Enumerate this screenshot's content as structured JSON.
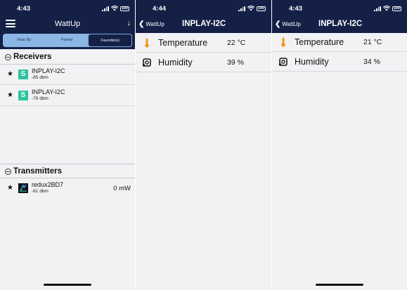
{
  "screens": [
    {
      "status_time": "4:43",
      "battery": "100",
      "app_title": "WattUp",
      "tabs": [
        "Near By",
        "Paired",
        "Favorite(s)"
      ],
      "active_tab": 2,
      "receivers_heading": "Receivers",
      "receivers": [
        {
          "icon_letter": "S",
          "name": "INPLAY-I2C",
          "signal": "-85 dbm"
        },
        {
          "icon_letter": "S",
          "name": "INPLAY-I2C",
          "signal": "-78 dbm"
        }
      ],
      "transmitters_heading": "Transmitters",
      "transmitters": [
        {
          "name": "redux2BD7",
          "signal": "-61 dbm",
          "power": "0 mW"
        }
      ]
    },
    {
      "status_time": "4:44",
      "battery": "100",
      "back_label": "WattUp",
      "title": "INPLAY-I2C",
      "readings": [
        {
          "icon": "thermometer-icon",
          "label": "Temperature",
          "value": "22 °C"
        },
        {
          "icon": "humidity-sensor-icon",
          "label": "Humidity",
          "value": "39 %"
        }
      ]
    },
    {
      "status_time": "4:43",
      "battery": "100",
      "back_label": "WattUp",
      "title": "INPLAY-I2C",
      "readings": [
        {
          "icon": "thermometer-icon",
          "label": "Temperature",
          "value": "21 °C"
        },
        {
          "icon": "humidity-sensor-icon",
          "label": "Humidity",
          "value": "34 %"
        }
      ]
    }
  ],
  "colors": {
    "header_bg": "#142046",
    "segment_bg": "#8cb6e4",
    "receiver_icon": "#2ec4a0",
    "thermometer": "#f29a1f",
    "screen_bg": "#f2f2f4"
  }
}
